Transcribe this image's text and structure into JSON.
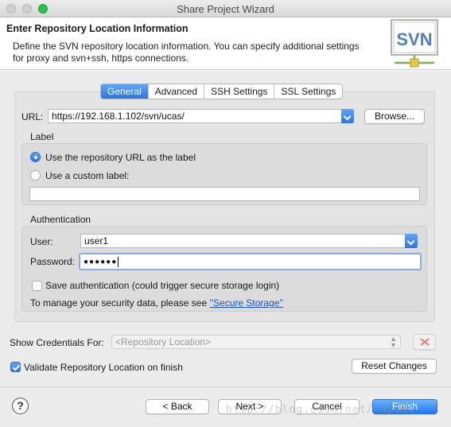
{
  "window": {
    "title": "Share Project Wizard",
    "buttons": [
      "close",
      "minimize",
      "zoom"
    ]
  },
  "header": {
    "title": "Enter Repository Location Information",
    "description": "Define the SVN repository location information. You can specify additional settings for proxy and svn+ssh, https connections.",
    "logo_text": "SVN"
  },
  "tabs": [
    {
      "label": "General",
      "active": true
    },
    {
      "label": "Advanced",
      "active": false
    },
    {
      "label": "SSH Settings",
      "active": false
    },
    {
      "label": "SSL Settings",
      "active": false
    }
  ],
  "general": {
    "url_label": "URL:",
    "url_value": "https://192.168.1.102/svn/ucas/",
    "browse_label": "Browse...",
    "label_group": {
      "title": "Label",
      "option_repo_url": "Use the repository URL as the label",
      "option_custom": "Use a custom label:",
      "selected": "repo_url",
      "custom_value": ""
    },
    "auth_group": {
      "title": "Authentication",
      "user_label": "User:",
      "user_value": "user1",
      "password_label": "Password:",
      "password_value": "●●●●●●",
      "save_auth_label": "Save authentication (could trigger secure storage login)",
      "save_auth_checked": false,
      "manage_text": "To manage your security data, please see ",
      "manage_link": "''Secure Storage''"
    }
  },
  "credentials": {
    "label": "Show Credentials For:",
    "value": "<Repository Location>"
  },
  "validate": {
    "label": "Validate Repository Location on finish",
    "checked": true
  },
  "reset_label": "Reset Changes",
  "footer": {
    "help_label": "?",
    "back_label": "< Back",
    "next_label": "Next >",
    "cancel_label": "Cancel",
    "finish_label": "Finish"
  },
  "watermark": "http://blog.csdn.net/mapedy",
  "colors": {
    "accent": "#2a76e6",
    "link": "#1b52c9",
    "content_bg": "#ececec"
  }
}
